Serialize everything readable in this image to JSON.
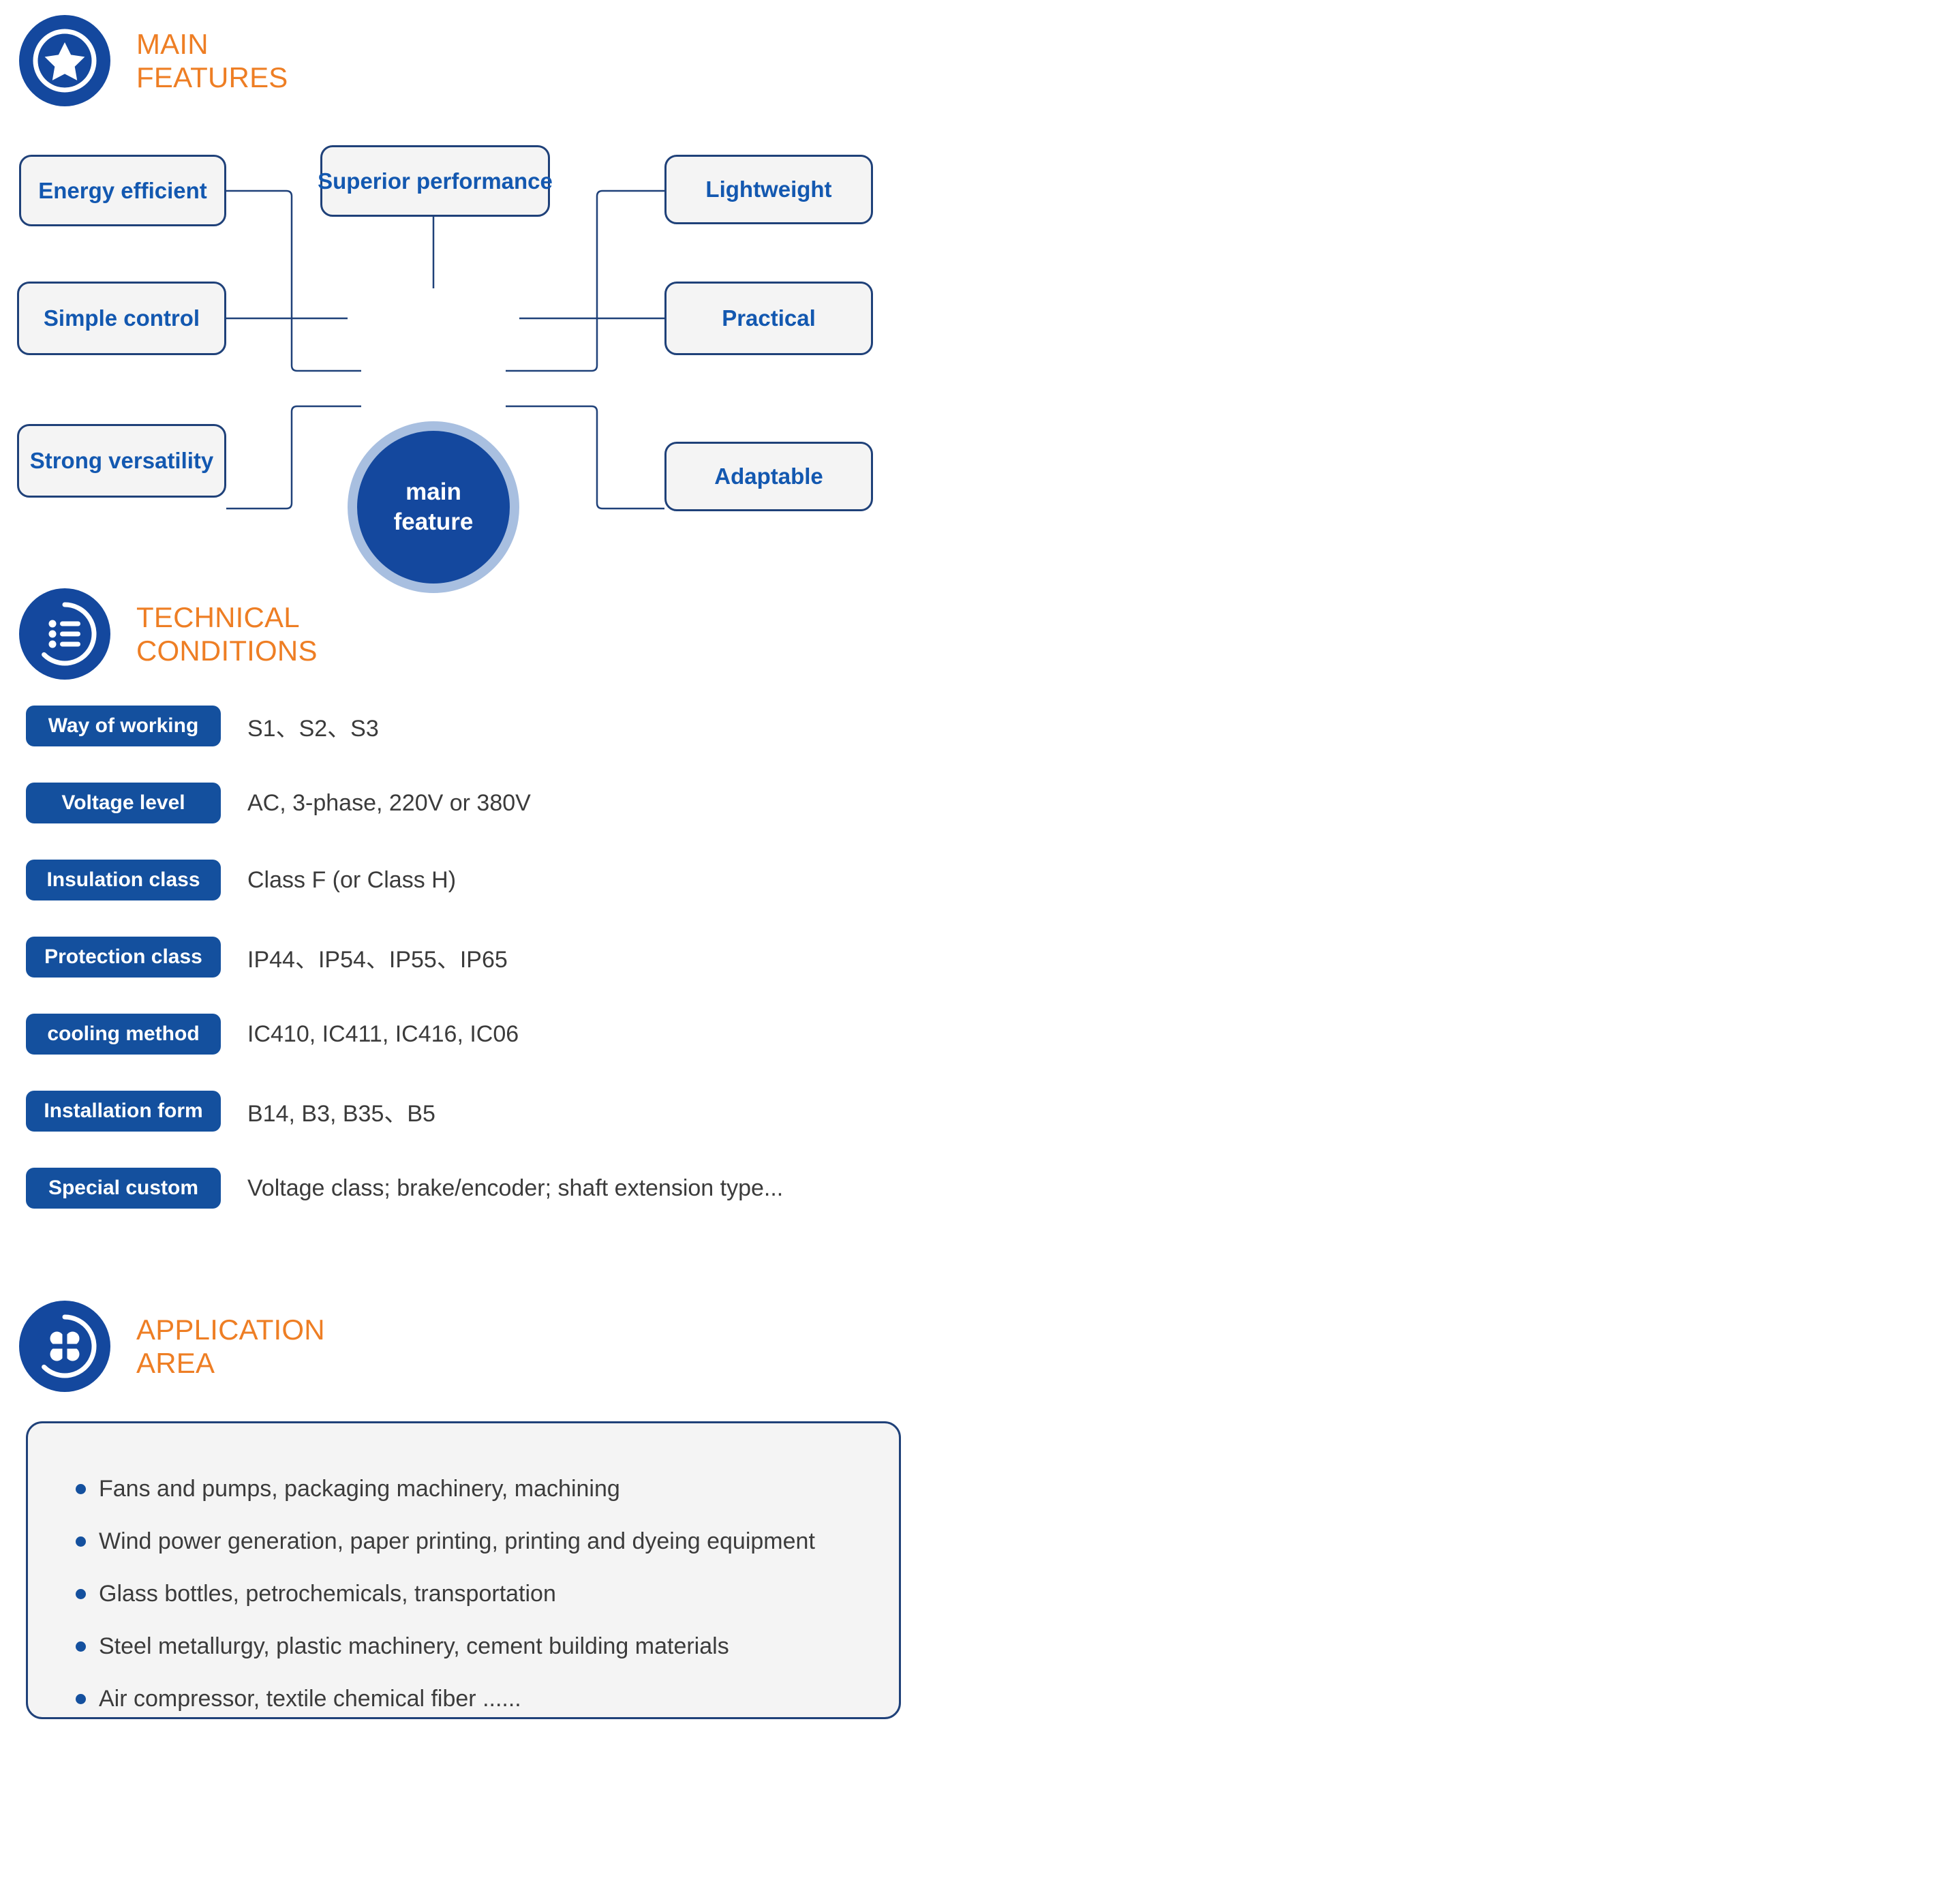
{
  "theme": {
    "brand_blue": "#14489E",
    "badge_blue": "#14509E",
    "accent_orange": "#EE7E24",
    "box_fill": "#F4F4F4",
    "box_border": "#1F4179",
    "ring_blue": "#A8BFE0",
    "body_text": "#3B3B3B",
    "label_blue": "#1358B0"
  },
  "sections": {
    "main_features": {
      "title": "MAIN\nFEATURES",
      "icon": "star-badge-icon"
    },
    "technical_conditions": {
      "title": "TECHNICAL\nCONDITIONS",
      "icon": "list-circle-icon"
    },
    "application_area": {
      "title": "APPLICATION\nAREA",
      "icon": "clover-circle-icon"
    }
  },
  "mindmap": {
    "center_line1": "main",
    "center_line2": "feature",
    "nodes": [
      {
        "label": "Energy efficient"
      },
      {
        "label": "Superior performance"
      },
      {
        "label": "Lightweight"
      },
      {
        "label": "Simple control"
      },
      {
        "label": "Practical"
      },
      {
        "label": "Strong versatility"
      },
      {
        "label": "Adaptable"
      }
    ]
  },
  "specs": [
    {
      "label": "Way of working",
      "value": "S1、S2、S3"
    },
    {
      "label": "Voltage level",
      "value": "AC, 3-phase, 220V or 380V"
    },
    {
      "label": "Insulation class",
      "value": "Class F (or Class H)"
    },
    {
      "label": "Protection class",
      "value": "IP44、IP54、IP55、IP65"
    },
    {
      "label": "cooling method",
      "value": "IC410, IC411, IC416, IC06"
    },
    {
      "label": "Installation form",
      "value": "B14, B3, B35、B5"
    },
    {
      "label": "Special custom",
      "value": "Voltage class; brake/encoder; shaft extension type..."
    }
  ],
  "applications": [
    {
      "text": "Fans and pumps, packaging machinery, machining"
    },
    {
      "text": "Wind power generation, paper printing, printing and dyeing equipment"
    },
    {
      "text": "Glass bottles, petrochemicals, transportation"
    },
    {
      "text": "Steel metallurgy, plastic machinery, cement building materials"
    },
    {
      "text": "Air compressor, textile chemical fiber ......"
    }
  ]
}
